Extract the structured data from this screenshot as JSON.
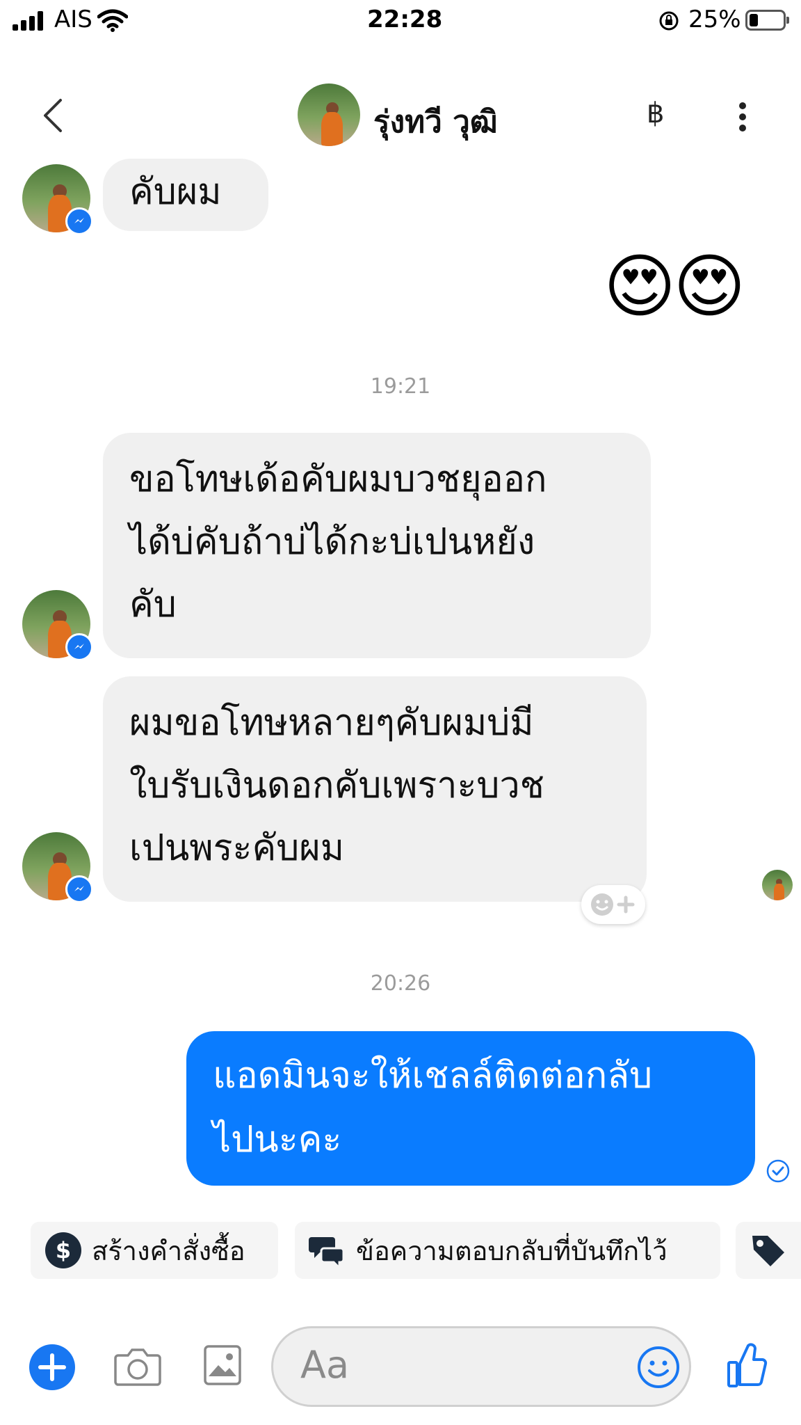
{
  "status_bar": {
    "carrier": "AIS",
    "time": "22:28",
    "battery_percent": "25%",
    "battery_level": 0.25
  },
  "header": {
    "contact_name": "รุ่งทวี วุฒิ",
    "payment_glyph": "฿",
    "back_icon": "chevron-left-icon",
    "more_icon": "more-vertical-icon"
  },
  "messages": [
    {
      "from": "contact",
      "text": "คับผม"
    },
    {
      "from": "me",
      "text": "😍😍"
    },
    {
      "from": "system",
      "text": "19:21"
    },
    {
      "from": "contact",
      "lines": [
        "ขอโทษเด้อคับผมบวชยุออก",
        "ได้บ่คับถ้าบ่ได้กะบ่เปนหยัง",
        "คับ"
      ]
    },
    {
      "from": "contact",
      "lines": [
        "ผมขอโทษหลายๆคับผมบ่มี",
        "ใบรับเงินดอกคับเพราะบวช",
        "เปนพระคับผม"
      ]
    },
    {
      "from": "system",
      "text": "20:26"
    },
    {
      "from": "me",
      "lines": [
        "แอดมินจะให้เชลล์ติดต่อกลับ",
        "ไปนะคะ"
      ]
    }
  ],
  "quick_replies": [
    {
      "label": "สร้างคำสั่งซื้อ",
      "icon": "dollar-circle-icon"
    },
    {
      "label": "ข้อความตอบกลับที่บันทึกไว้",
      "icon": "chat-bubbles-icon"
    },
    {
      "label": "",
      "icon": "tag-icon"
    }
  ],
  "composer": {
    "placeholder": "Aa",
    "icons": [
      "plus-circle-icon",
      "camera-icon",
      "image-icon",
      "emoji-icon",
      "thumbs-up-icon"
    ]
  },
  "colors": {
    "accent": "#0a7cff",
    "incoming_bubble": "#f0f0f0",
    "timestamp": "#9b9b9b"
  }
}
